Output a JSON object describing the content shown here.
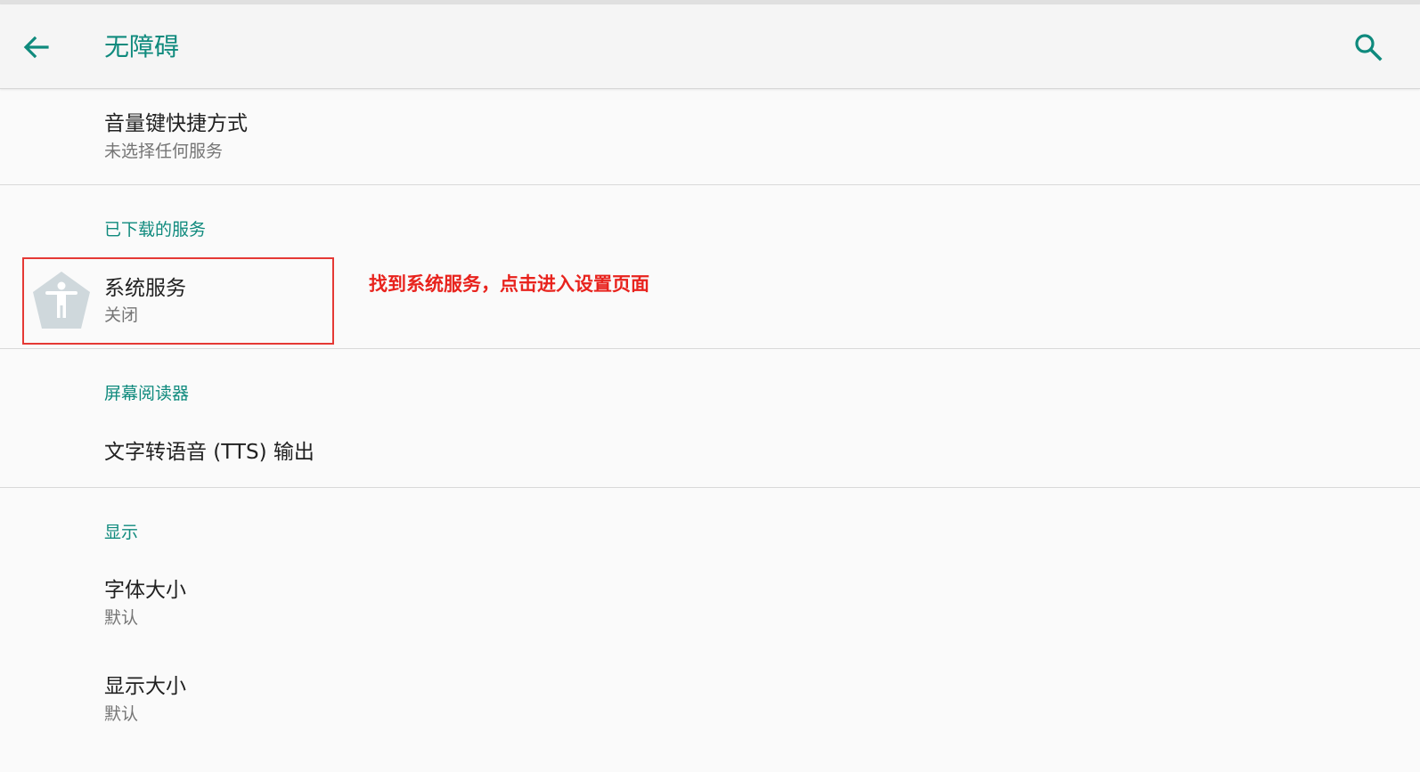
{
  "app_bar": {
    "title": "无障碍",
    "back_icon": "arrow-back-icon",
    "search_icon": "search-icon"
  },
  "accent_color": "#0f8a7d",
  "annotation_color": "#e8231d",
  "volume_shortcut": {
    "title": "音量键快捷方式",
    "summary": "未选择任何服务"
  },
  "downloaded_services": {
    "header": "已下载的服务",
    "items": [
      {
        "title": "系统服务",
        "summary": "关闭",
        "icon": "accessibility-icon"
      }
    ]
  },
  "annotation": "找到系统服务，点击进入设置页面",
  "screen_reader": {
    "header": "屏幕阅读器",
    "items": [
      {
        "title": "文字转语音 (TTS) 输出"
      }
    ]
  },
  "display": {
    "header": "显示",
    "items": [
      {
        "title": "字体大小",
        "summary": "默认"
      },
      {
        "title": "显示大小",
        "summary": "默认"
      }
    ]
  }
}
